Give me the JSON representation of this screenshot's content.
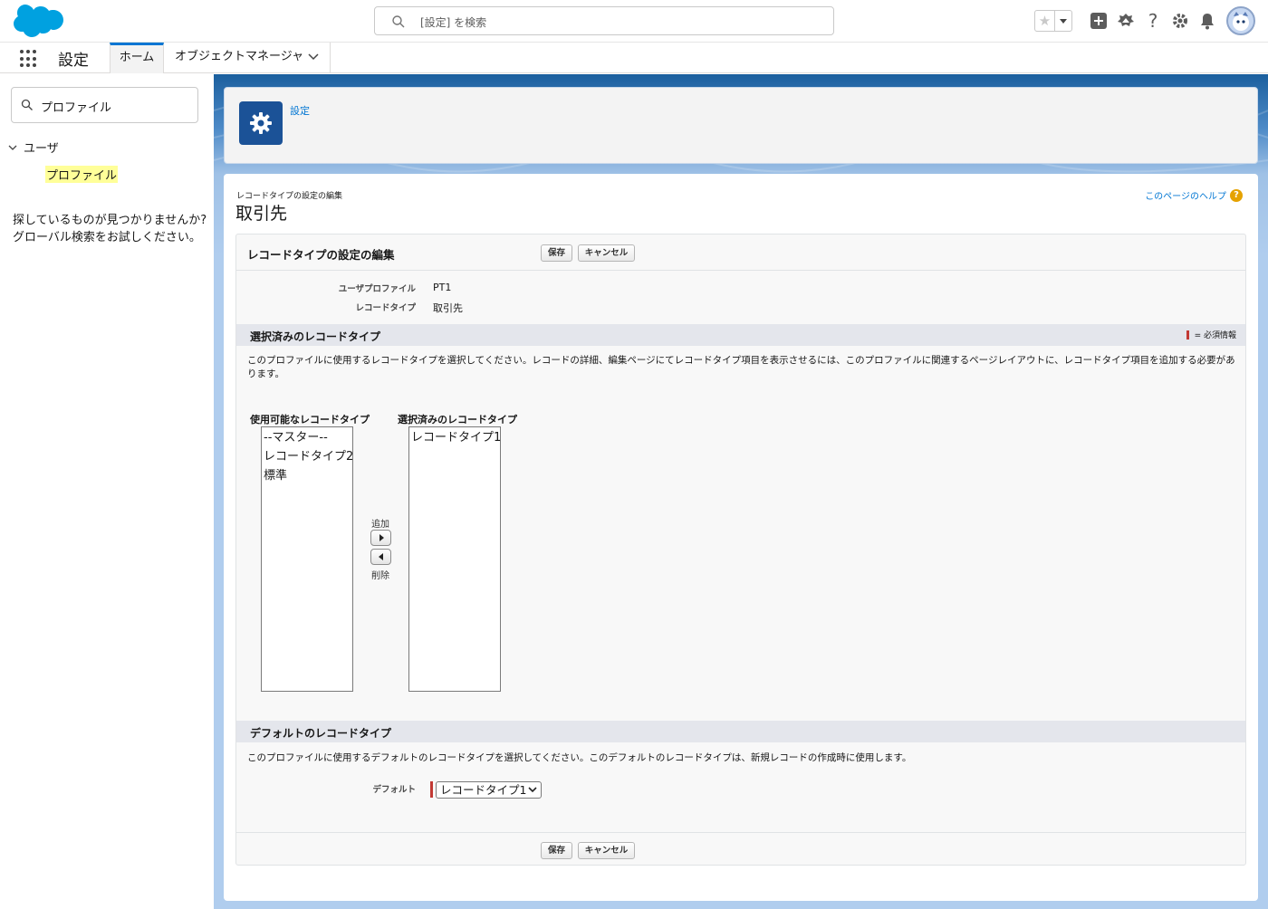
{
  "header": {
    "search_placeholder": "[設定] を検索"
  },
  "nav": {
    "app_name": "設定",
    "tabs": [
      {
        "label": "ホーム"
      },
      {
        "label": "オブジェクトマネージャ"
      }
    ]
  },
  "sidebar": {
    "search_value": "プロファイル",
    "tree": {
      "group_label": "ユーザ",
      "item_label": "プロファイル"
    },
    "hint_line1": "探しているものが見つかりませんか?",
    "hint_line2": "グローバル検索をお試しください。"
  },
  "page_header": {
    "breadcrumb": "設定"
  },
  "page": {
    "subtitle": "レコードタイプの設定の編集",
    "title": "取引先",
    "help_link": "このページのヘルプ"
  },
  "form": {
    "title": "レコードタイプの設定の編集",
    "save_label": "保存",
    "cancel_label": "キャンセル",
    "fields": [
      {
        "label": "ユーザプロファイル",
        "value": "PT1"
      },
      {
        "label": "レコードタイプ",
        "value": "取引先"
      }
    ],
    "selected_section": {
      "title": "選択済みのレコードタイプ",
      "required_legend": "= 必須情報",
      "description": "このプロファイルに使用するレコードタイプを選択してください。レコードの詳細、編集ページにてレコードタイプ項目を表示させるには、このプロファイルに関連するページレイアウトに、レコードタイプ項目を追加する必要があります。",
      "available_header": "使用可能なレコードタイプ",
      "selected_header": "選択済みのレコードタイプ",
      "available_options": [
        "--マスター--",
        "レコードタイプ2",
        "標準"
      ],
      "selected_options": [
        "レコードタイプ1"
      ],
      "add_label": "追加",
      "remove_label": "削除"
    },
    "default_section": {
      "title": "デフォルトのレコードタイプ",
      "description": "このプロファイルに使用するデフォルトのレコードタイプを選択してください。このデフォルトのレコードタイプは、新規レコードの作成時に使用します。",
      "default_label": "デフォルト",
      "default_value": "レコードタイプ1"
    }
  },
  "colors": {
    "brand_blue": "#0176d3",
    "required_red": "#c23934",
    "gear_tile": "#1b5297",
    "highlight": "#ffff99"
  }
}
